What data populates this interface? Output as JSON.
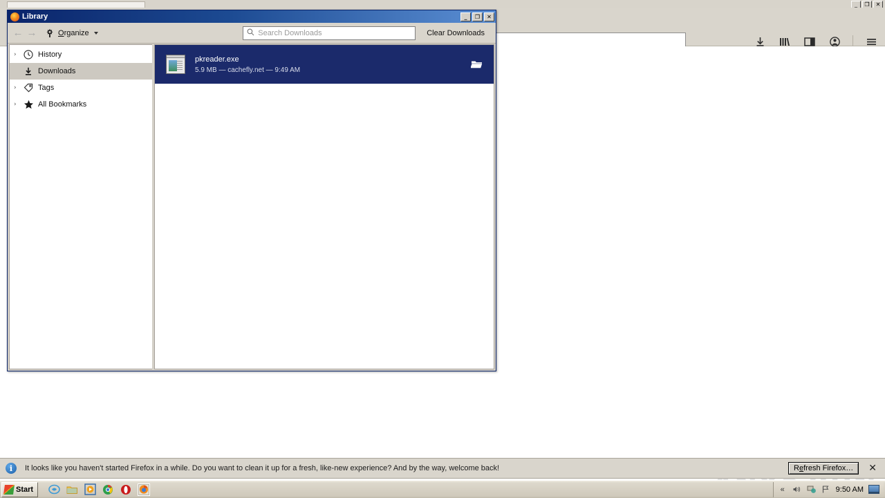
{
  "background_window": {
    "name": "firefox-browser",
    "urlbar_value": "",
    "urlbar_placeholder": "",
    "window_buttons": {
      "minimize": "_",
      "maximize": "❐",
      "close": "✕"
    },
    "toolbar_icons": [
      {
        "name": "downloads-icon",
        "glyph": "⭳"
      },
      {
        "name": "library-icon",
        "glyph": "|||\\"
      },
      {
        "name": "sidebar-icon",
        "glyph": "▤"
      },
      {
        "name": "account-icon",
        "glyph": "☻"
      },
      {
        "name": "menu-icon",
        "glyph": "☰"
      }
    ],
    "nav_back": "←",
    "nav_forward": "→"
  },
  "library": {
    "title": "Library",
    "window_buttons": {
      "minimize": "_",
      "maximize": "❐",
      "close": "✕"
    },
    "toolbar": {
      "back": "←",
      "forward": "→",
      "organize_label": "Organize",
      "search_placeholder": "Search Downloads",
      "search_value": "",
      "clear_downloads_label": "Clear Downloads"
    },
    "sidebar": {
      "items": [
        {
          "label": "History",
          "icon": "clock-icon",
          "twisty": "›",
          "selected": false
        },
        {
          "label": "Downloads",
          "icon": "download-icon",
          "twisty": "",
          "selected": true
        },
        {
          "label": "Tags",
          "icon": "tag-icon",
          "twisty": "›",
          "selected": false
        },
        {
          "label": "All Bookmarks",
          "icon": "star-icon",
          "twisty": "›",
          "selected": false
        }
      ]
    },
    "downloads": [
      {
        "filename": "pkreader.exe",
        "details": "5.9 MB — cachefly.net — 9:49 AM",
        "size": "5.9 MB",
        "source": "cachefly.net",
        "time": "9:49 AM",
        "selected": true,
        "action_icon": "open-folder-icon"
      }
    ]
  },
  "notification": {
    "icon": "info-icon",
    "message": "It looks like you haven't started Firefox in a while. Do you want to clean it up for a fresh, like-new experience? And by the way, welcome back!",
    "action_label": "Refresh Firefox…",
    "close_label": "✕"
  },
  "taskbar": {
    "start_label": "Start",
    "quick_launch": [
      {
        "name": "internet-explorer-icon",
        "glyph": "e"
      },
      {
        "name": "file-explorer-icon",
        "glyph": "🗀"
      },
      {
        "name": "media-player-icon",
        "glyph": "▶"
      },
      {
        "name": "chrome-icon",
        "glyph": "◍"
      },
      {
        "name": "opera-icon",
        "glyph": "O"
      },
      {
        "name": "firefox-taskbar-icon",
        "glyph": "◉"
      }
    ],
    "tray": {
      "chevron": "«",
      "volume_icon": "◁))",
      "network_icon": "⛁",
      "flag_icon": "⚑",
      "clock": "9:50 AM"
    }
  },
  "watermark": {
    "left_text": "ANY",
    "right_text": "RUN"
  },
  "colors": {
    "title_blue": "#0a246a",
    "selection_blue": "#1b2a6b",
    "chrome_gray": "#d9d5cc"
  }
}
